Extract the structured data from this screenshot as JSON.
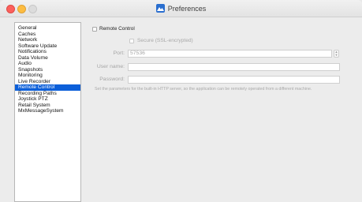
{
  "window": {
    "title": "Preferences"
  },
  "sidebar": {
    "items": [
      {
        "label": "General"
      },
      {
        "label": "Caches"
      },
      {
        "label": "Network"
      },
      {
        "label": "Software Update"
      },
      {
        "label": "Notifications"
      },
      {
        "label": "Data Volume"
      },
      {
        "label": "Audio"
      },
      {
        "label": "Snapshots"
      },
      {
        "label": "Monitoring"
      },
      {
        "label": "Live Recorder"
      },
      {
        "label": "Remote Control",
        "selected": true
      },
      {
        "label": "Recording Paths"
      },
      {
        "label": "Joystick PTZ"
      },
      {
        "label": "Retail System"
      },
      {
        "label": "MxMessageSystem"
      }
    ]
  },
  "panel": {
    "remote_control_label": "Remote Control",
    "remote_control_checked": false,
    "secure_label": "Secure (SSL-encrypted)",
    "secure_checked": false,
    "port_label": "Port:",
    "port_value": "57536",
    "username_label": "User name:",
    "username_value": "",
    "password_label": "Password:",
    "password_value": "",
    "hint": "Set the parameters for the built-in HTTP server, so the application can be remotely operated from a different machine."
  },
  "icons": {
    "stepper_up": "▲",
    "stepper_down": "▼"
  },
  "colors": {
    "selection": "#0c5fd9",
    "close": "#fc605c",
    "minimize": "#fdbc40"
  }
}
